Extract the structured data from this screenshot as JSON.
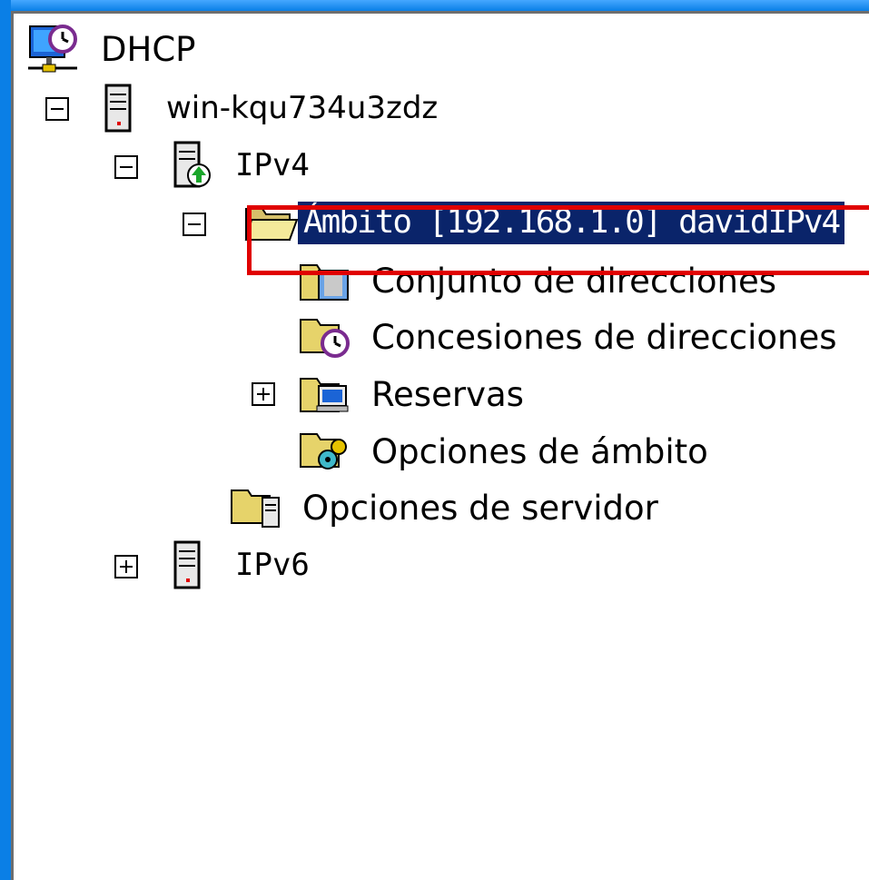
{
  "tree": {
    "root": {
      "label": "DHCP",
      "icon": "dhcp-clock-icon"
    },
    "server": {
      "label": "win-kqu734u3zdz",
      "icon": "server-icon",
      "expanded": true
    },
    "ipv4": {
      "label": "IPv4",
      "icon": "ipv4-server-icon",
      "expanded": true
    },
    "scope": {
      "label": "Ámbito [192.168.1.0] davidIPv4",
      "icon": "folder-open-icon",
      "expanded": true,
      "selected": true
    },
    "scope_children": [
      {
        "label": "Conjunto de direcciones",
        "icon": "address-pool-icon"
      },
      {
        "label": "Concesiones de direcciones",
        "icon": "address-leases-icon"
      },
      {
        "label": "Reservas",
        "icon": "reservations-icon",
        "expandable": true
      },
      {
        "label": "Opciones de ámbito",
        "icon": "scope-options-icon"
      }
    ],
    "server_options": {
      "label": "Opciones de servidor",
      "icon": "server-options-icon"
    },
    "ipv6": {
      "label": "IPv6",
      "icon": "server-icon",
      "expanded": false
    }
  },
  "colors": {
    "frame": "#0a7fe6",
    "selection_bg": "#0a246a",
    "highlight": "#e00000"
  }
}
